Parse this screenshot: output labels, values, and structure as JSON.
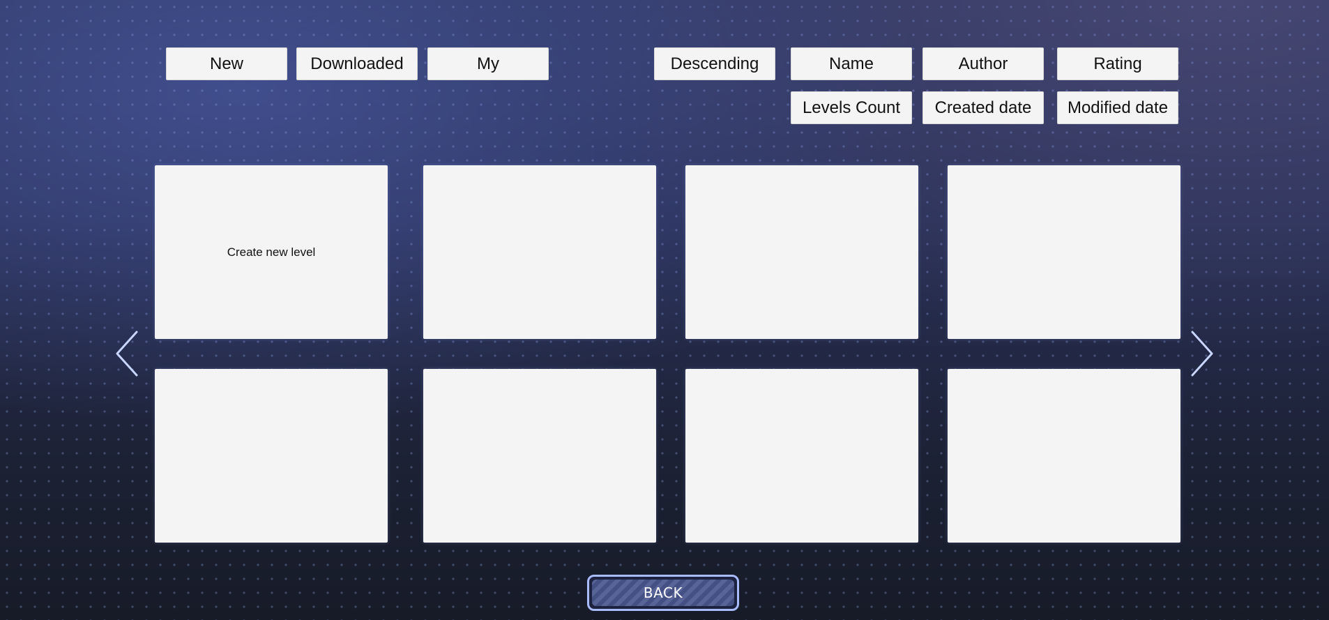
{
  "filters": {
    "new": "New",
    "downloaded": "Downloaded",
    "my": "My"
  },
  "sort": {
    "order": "Descending",
    "name": "Name",
    "author": "Author",
    "rating": "Rating",
    "levels_count": "Levels Count",
    "created_date": "Created date",
    "modified_date": "Modified date"
  },
  "grid": {
    "create_new_level": "Create new level"
  },
  "navigation": {
    "prev_icon": "chevron-left-icon",
    "next_icon": "chevron-right-icon",
    "back_label": "BACK"
  },
  "colors": {
    "button_bg": "#f4f4f4",
    "back_border": "#a9bcff",
    "arrow": "#c9d6ff"
  }
}
